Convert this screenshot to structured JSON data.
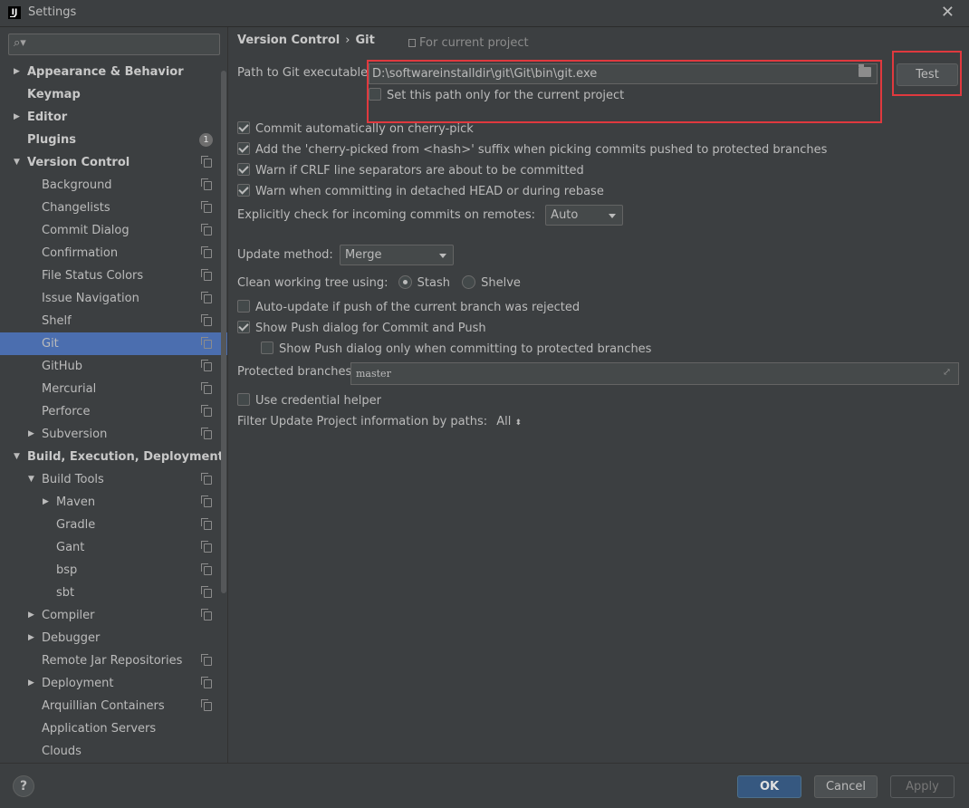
{
  "window": {
    "title": "Settings"
  },
  "sidebar": {
    "search_placeholder": "",
    "items": [
      {
        "label": "Appearance & Behavior",
        "level": 0,
        "arrow": "right",
        "bold": true
      },
      {
        "label": "Keymap",
        "level": 0,
        "bold": true
      },
      {
        "label": "Editor",
        "level": 0,
        "arrow": "right",
        "bold": true
      },
      {
        "label": "Plugins",
        "level": 0,
        "bold": true,
        "badge": "1"
      },
      {
        "label": "Version Control",
        "level": 0,
        "arrow": "down",
        "bold": true,
        "copy": true
      },
      {
        "label": "Background",
        "level": 1,
        "copy": true
      },
      {
        "label": "Changelists",
        "level": 1,
        "copy": true
      },
      {
        "label": "Commit Dialog",
        "level": 1,
        "copy": true
      },
      {
        "label": "Confirmation",
        "level": 1,
        "copy": true
      },
      {
        "label": "File Status Colors",
        "level": 1,
        "copy": true
      },
      {
        "label": "Issue Navigation",
        "level": 1,
        "copy": true
      },
      {
        "label": "Shelf",
        "level": 1,
        "copy": true
      },
      {
        "label": "Git",
        "level": 1,
        "copy": true,
        "selected": true
      },
      {
        "label": "GitHub",
        "level": 1,
        "copy": true
      },
      {
        "label": "Mercurial",
        "level": 1,
        "copy": true
      },
      {
        "label": "Perforce",
        "level": 1,
        "copy": true
      },
      {
        "label": "Subversion",
        "level": 1,
        "arrow": "right",
        "copy": true
      },
      {
        "label": "Build, Execution, Deployment",
        "level": 0,
        "arrow": "down",
        "bold": true
      },
      {
        "label": "Build Tools",
        "level": 1,
        "arrow": "down",
        "copy": true
      },
      {
        "label": "Maven",
        "level": 2,
        "arrow": "right",
        "copy": true
      },
      {
        "label": "Gradle",
        "level": 2,
        "copy": true
      },
      {
        "label": "Gant",
        "level": 2,
        "copy": true
      },
      {
        "label": "bsp",
        "level": 2,
        "copy": true
      },
      {
        "label": "sbt",
        "level": 2,
        "copy": true
      },
      {
        "label": "Compiler",
        "level": 1,
        "arrow": "right",
        "copy": true
      },
      {
        "label": "Debugger",
        "level": 1,
        "arrow": "right"
      },
      {
        "label": "Remote Jar Repositories",
        "level": 1,
        "copy": true
      },
      {
        "label": "Deployment",
        "level": 1,
        "arrow": "right",
        "copy": true
      },
      {
        "label": "Arquillian Containers",
        "level": 1,
        "copy": true
      },
      {
        "label": "Application Servers",
        "level": 1
      },
      {
        "label": "Clouds",
        "level": 1
      }
    ]
  },
  "main": {
    "breadcrumb": {
      "parent": "Version Control",
      "separator": "›",
      "current": "Git"
    },
    "for_project": "For current project",
    "path_label": "Path to Git executable:",
    "path_value": "D:\\softwareinstalldir\\git\\Git\\bin\\git.exe",
    "path_only_project": "Set this path only for the current project",
    "test_button": "Test",
    "checkboxes": [
      {
        "label": "Commit automatically on cherry-pick",
        "checked": true
      },
      {
        "label": "Add the 'cherry-picked from <hash>' suffix when picking commits pushed to protected branches",
        "checked": true
      },
      {
        "label": "Warn if CRLF line separators are about to be committed",
        "checked": true
      },
      {
        "label": "Warn when committing in detached HEAD or during rebase",
        "checked": true
      }
    ],
    "incoming_label": "Explicitly check for incoming commits on remotes:",
    "incoming_value": "Auto",
    "update_label": "Update method:",
    "update_value": "Merge",
    "clean_label": "Clean working tree using:",
    "clean_stash": "Stash",
    "clean_shelve": "Shelve",
    "auto_update": "Auto-update if push of the current branch was rejected",
    "show_push": "Show Push dialog for Commit and Push",
    "show_push_protected": "Show Push dialog only when committing to protected branches",
    "protected_label": "Protected branches:",
    "protected_value": "master",
    "credential_helper": "Use credential helper",
    "filter_label": "Filter Update Project information by paths:",
    "filter_value": "All"
  },
  "footer": {
    "help": "?",
    "ok": "OK",
    "cancel": "Cancel",
    "apply": "Apply"
  },
  "colors": {
    "background": "#3c3f41",
    "selection": "#4b6eaf",
    "highlight_box": "#e0393e",
    "ok_button": "#365880"
  }
}
